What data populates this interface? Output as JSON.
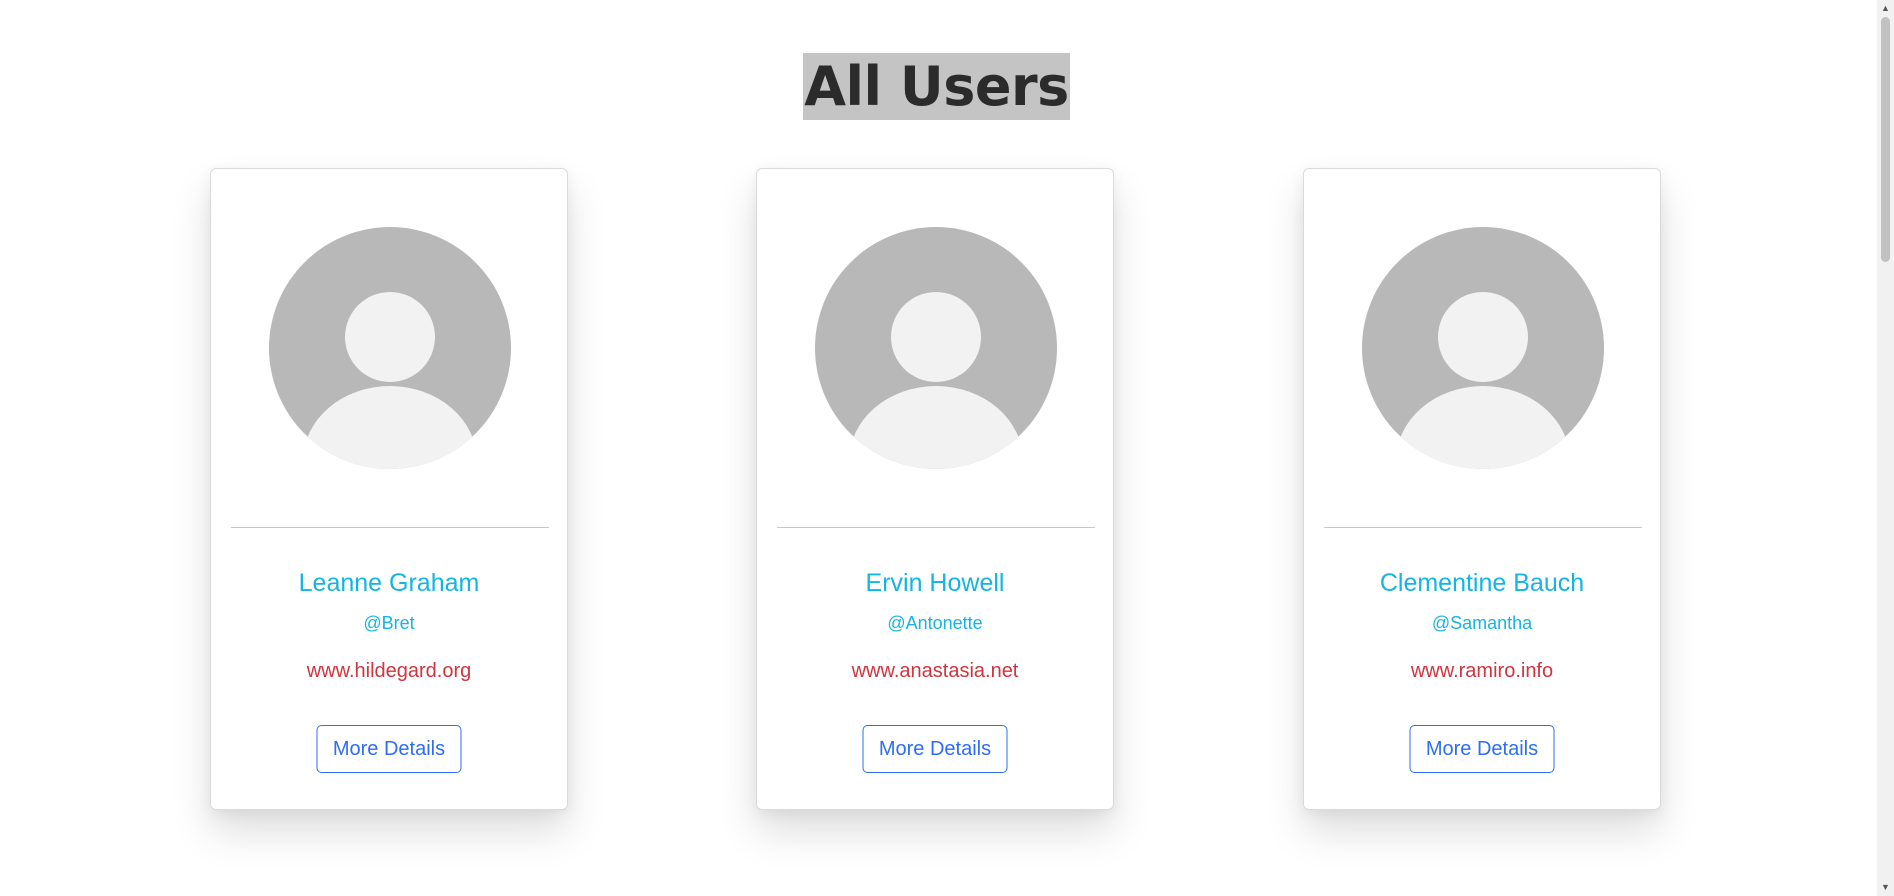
{
  "page": {
    "title": "All Users"
  },
  "users": [
    {
      "name": "Leanne Graham",
      "username": "@Bret",
      "website": "www.hildegard.org",
      "button_label": "More Details"
    },
    {
      "name": "Ervin Howell",
      "username": "@Antonette",
      "website": "www.anastasia.net",
      "button_label": "More Details"
    },
    {
      "name": "Clementine Bauch",
      "username": "@Samantha",
      "website": "www.ramiro.info",
      "button_label": "More Details"
    }
  ],
  "icons": {
    "avatar": "user-avatar-placeholder-icon",
    "scroll_up": "scroll-up-arrow-icon",
    "scroll_down": "scroll-down-arrow-icon"
  },
  "colors": {
    "name": "#14b4e4",
    "username": "#14b4e4",
    "website": "#d0343e",
    "button": "#2d6ef5",
    "title_highlight": "#c4c4c4"
  }
}
